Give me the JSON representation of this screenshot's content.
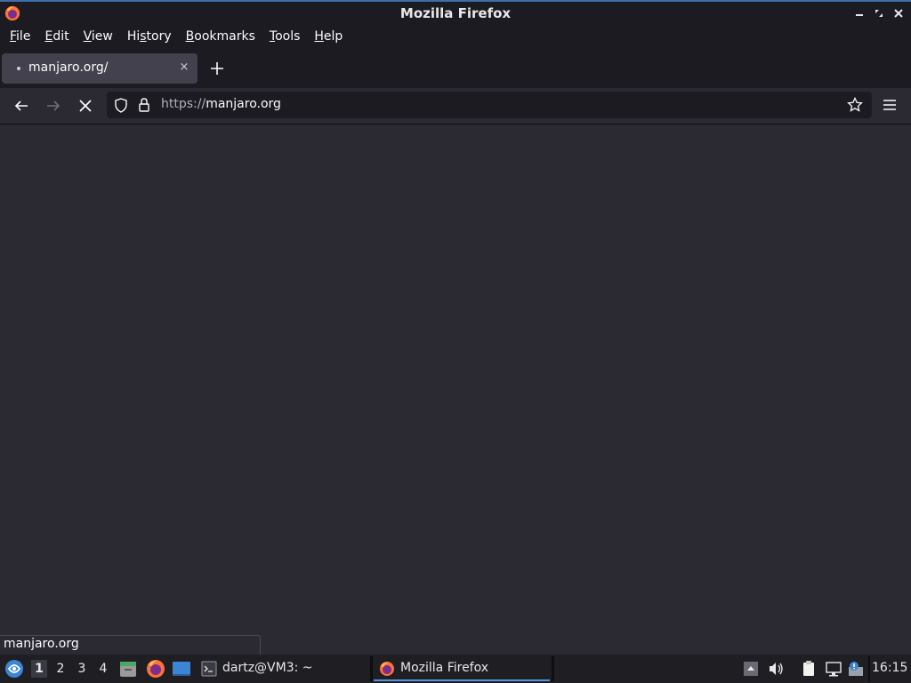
{
  "window": {
    "title": "Mozilla Firefox",
    "controls": [
      "minimize",
      "maximize",
      "close"
    ]
  },
  "menubar": {
    "items": [
      {
        "label_pre": "",
        "accel": "F",
        "label_post": "ile"
      },
      {
        "label_pre": "",
        "accel": "E",
        "label_post": "dit"
      },
      {
        "label_pre": "",
        "accel": "V",
        "label_post": "iew"
      },
      {
        "label_pre": "Hi",
        "accel": "s",
        "label_post": "tory"
      },
      {
        "label_pre": "",
        "accel": "B",
        "label_post": "ookmarks"
      },
      {
        "label_pre": "",
        "accel": "T",
        "label_post": "ools"
      },
      {
        "label_pre": "",
        "accel": "H",
        "label_post": "elp"
      }
    ]
  },
  "tabs": {
    "active": {
      "label": "manjaro.org/",
      "close": "×"
    },
    "new_tab": "+"
  },
  "navbar": {
    "url_scheme": "https://",
    "url_host": "manjaro.org"
  },
  "status": {
    "text": "manjaro.org"
  },
  "taskbar": {
    "workspaces": [
      "1",
      "2",
      "3",
      "4"
    ],
    "active_workspace": "1",
    "tasks": [
      {
        "label": "dartz@VM3: ~"
      },
      {
        "label": "Mozilla Firefox"
      }
    ],
    "clock": "16:15"
  },
  "colors": {
    "chrome_bg": "#1c1b22",
    "content_bg": "#2b2a33",
    "accent": "#5294e2"
  }
}
